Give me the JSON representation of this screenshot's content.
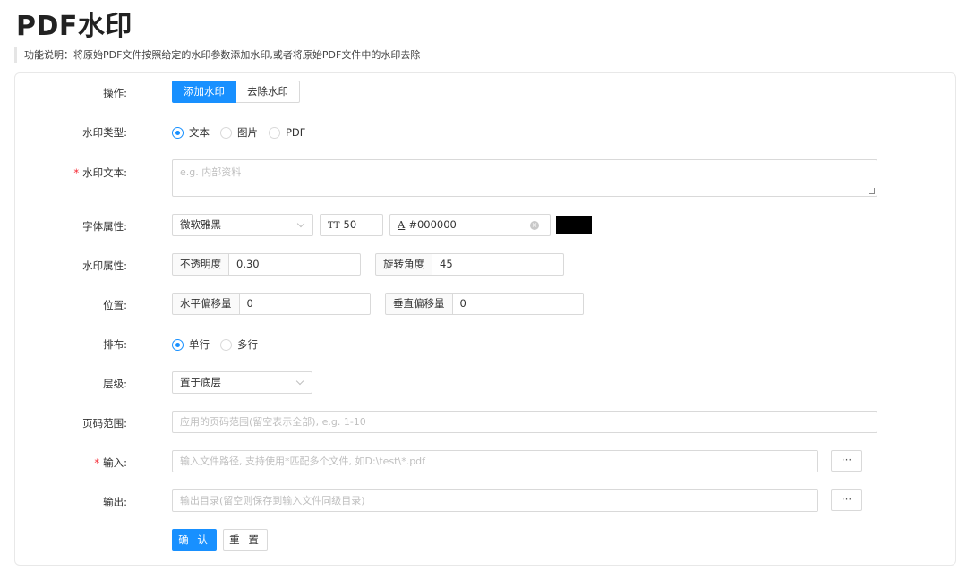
{
  "page": {
    "title": "PDF水印",
    "description": "功能说明：将原始PDF文件按照给定的水印参数添加水印,或者将原始PDF文件中的水印去除"
  },
  "form": {
    "operation": {
      "label": "操作:",
      "options": [
        "添加水印",
        "去除水印"
      ],
      "selected": "添加水印"
    },
    "watermark_type": {
      "label": "水印类型:",
      "options": [
        "文本",
        "图片",
        "PDF"
      ],
      "selected": "文本"
    },
    "watermark_text": {
      "label": "水印文本:",
      "required_mark": "*",
      "placeholder": "e.g. 内部资料"
    },
    "font": {
      "label": "字体属性:",
      "family": "微软雅黑",
      "size_icon": "TT",
      "size": "50",
      "color_icon": "A",
      "color_value": "#000000",
      "clear_icon": "×",
      "swatch_color": "#000000"
    },
    "watermark_attr": {
      "label": "水印属性:",
      "opacity_label": "不透明度",
      "opacity_value": "0.30",
      "rotation_label": "旋转角度",
      "rotation_value": "45"
    },
    "position": {
      "label": "位置:",
      "h_offset_label": "水平偏移量",
      "h_offset_value": "0",
      "v_offset_label": "垂直偏移量",
      "v_offset_value": "0"
    },
    "layout": {
      "label": "排布:",
      "options": [
        "单行",
        "多行"
      ],
      "selected": "单行"
    },
    "layer": {
      "label": "层级:",
      "value": "置于底层"
    },
    "page_range": {
      "label": "页码范围:",
      "placeholder": "应用的页码范围(留空表示全部), e.g. 1-10"
    },
    "input": {
      "label": "输入:",
      "required_mark": "*",
      "placeholder": "输入文件路径, 支持使用*匹配多个文件, 如D:\\test\\*.pdf",
      "browse_label": "···"
    },
    "output": {
      "label": "输出:",
      "placeholder": "输出目录(留空则保存到输入文件同级目录)",
      "browse_label": "···"
    },
    "confirm_label": "确 认",
    "reset_label": "重 置"
  },
  "colors": {
    "primary": "#1890ff",
    "required": "#f5222d",
    "border": "#d9d9d9"
  }
}
